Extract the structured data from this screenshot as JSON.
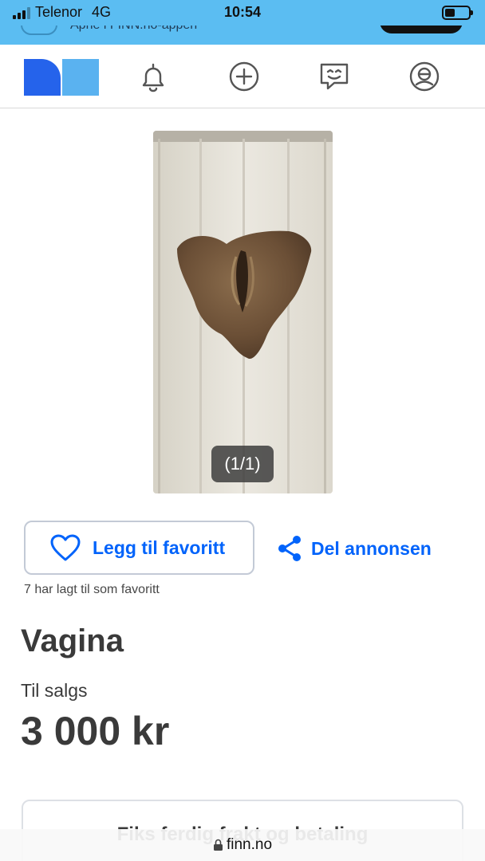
{
  "status_bar": {
    "carrier": "Telenor",
    "network": "4G",
    "time": "10:54"
  },
  "app_banner": {
    "text": "Åpne i FINN.no-appen"
  },
  "navbar": {
    "logo_colors": [
      "#2563eb",
      "#5ab2f0"
    ],
    "icons": [
      "bell-icon",
      "plus-circle-icon",
      "chat-icon",
      "profile-icon"
    ]
  },
  "gallery": {
    "counter": "(1/1)"
  },
  "actions": {
    "favorite_label": "Legg til favoritt",
    "share_label": "Del annonsen",
    "favorite_count_text": "7 har lagt til som favoritt"
  },
  "listing": {
    "title": "Vagina",
    "sale_status": "Til salgs",
    "price": "3 000 kr"
  },
  "card": {
    "text": "Fiks ferdig frakt og betaling"
  },
  "browser": {
    "url": "finn.no"
  },
  "colors": {
    "accent": "#0063fb",
    "status_bar_bg": "#5bbdf2",
    "text": "#3a3a3a"
  }
}
